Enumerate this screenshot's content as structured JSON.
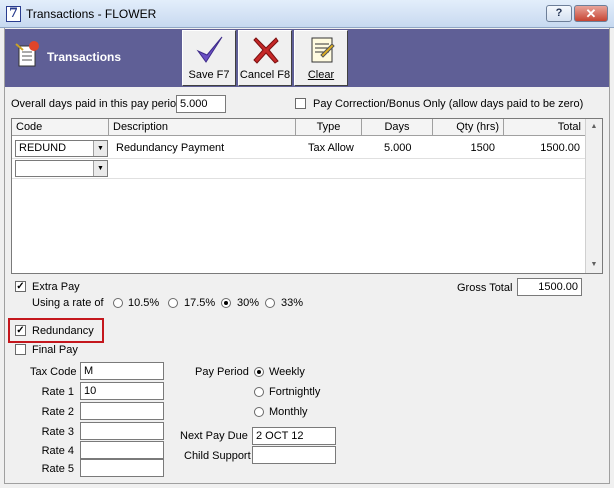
{
  "window": {
    "title": "Transactions - FLOWER",
    "icon_glyph": "7",
    "help_label": "?",
    "close_label": "✕"
  },
  "toolbar": {
    "title": "Transactions",
    "save_label": "Save F7",
    "cancel_label": "Cancel F8",
    "clear_label": "Clear"
  },
  "days": {
    "label": "Overall days paid in this pay period",
    "value": "5.000"
  },
  "pay_correction": {
    "label": "Pay Correction/Bonus Only (allow days paid to be zero)",
    "checked": false
  },
  "grid": {
    "columns": [
      "Code",
      "Description",
      "Type",
      "Days",
      "Qty (hrs)",
      "Total"
    ],
    "rows": [
      {
        "code": "REDUND",
        "description": "Redundancy Payment",
        "type": "Tax Allow",
        "days": "5.000",
        "qty": "1500",
        "total": "1500.00"
      },
      {
        "code": "",
        "description": "",
        "type": "",
        "days": "",
        "qty": "",
        "total": ""
      }
    ]
  },
  "extra_pay": {
    "label": "Extra Pay",
    "checked": true,
    "rate_label": "Using a rate of",
    "rates": [
      "10.5%",
      "17.5%",
      "30%",
      "33%"
    ],
    "selected_rate": "30%"
  },
  "gross_total": {
    "label": "Gross Total",
    "value": "1500.00"
  },
  "redundancy": {
    "label": "Redundancy",
    "checked": true
  },
  "final_pay": {
    "label": "Final Pay",
    "checked": false
  },
  "tax": {
    "code_label": "Tax Code",
    "code_value": "M",
    "rate1_label": "Rate 1",
    "rate1_value": "10",
    "rate2_label": "Rate 2",
    "rate2_value": "",
    "rate3_label": "Rate 3",
    "rate3_value": "",
    "rate4_label": "Rate 4",
    "rate4_value": "",
    "rate5_label": "Rate 5",
    "rate5_value": ""
  },
  "pay_period": {
    "label": "Pay Period",
    "options": [
      "Weekly",
      "Fortnightly",
      "Monthly"
    ],
    "selected": "Weekly"
  },
  "next_pay_due": {
    "label": "Next Pay Due",
    "value": "2 OCT 12"
  },
  "child_support": {
    "label": "Child Support",
    "value": ""
  },
  "colors": {
    "toolbar_bg": "#5f5f96",
    "highlight": "#c4171d",
    "cancel_x": "#c62828",
    "save_check": "#6a4fc4"
  }
}
